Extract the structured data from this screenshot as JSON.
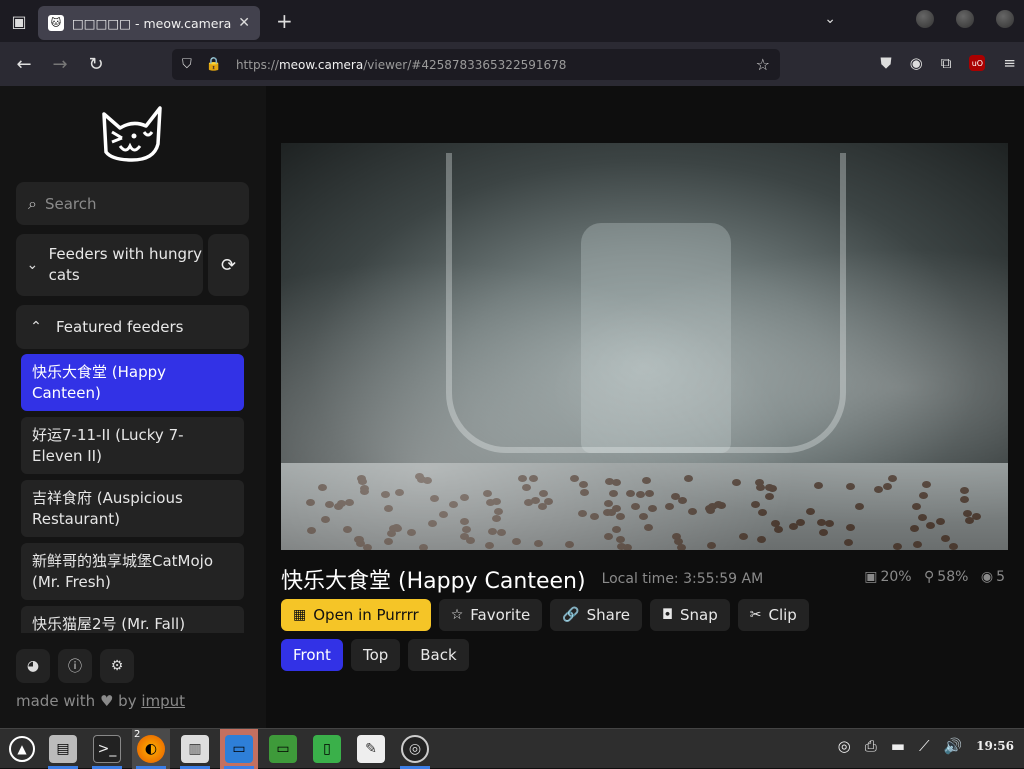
{
  "browser": {
    "tab_title": "□□□□□ - meow.camera",
    "url_prefix": "https://",
    "url_host": "meow.camera",
    "url_path": "/viewer/#4258783365322591678"
  },
  "sidebar": {
    "search_placeholder": "Search",
    "group_hungry": "Feeders with hungry cats",
    "group_featured": "Featured feeders",
    "feeders": [
      {
        "label": "快乐大食堂 (Happy Canteen)"
      },
      {
        "label": "好运7-11-II (Lucky 7-Eleven II)"
      },
      {
        "label": "吉祥食府 (Auspicious Restaurant)"
      },
      {
        "label": "新鲜哥的独享城堡CatMojo (Mr. Fresh)"
      },
      {
        "label": "快乐猫屋2号 (Mr. Fall)"
      }
    ],
    "made_with": "made with",
    "by": "by",
    "author": "imput"
  },
  "viewer": {
    "feeder_title": "快乐大食堂 (Happy Canteen)",
    "local_time": "Local time: 3:55:59 AM",
    "food_level": "20%",
    "health": "58%",
    "viewers": "5",
    "actions": {
      "open": "Open in Purrrr",
      "favorite": "Favorite",
      "share": "Share",
      "snap": "Snap",
      "clip": "Clip"
    },
    "views": {
      "front": "Front",
      "top": "Top",
      "back": "Back"
    }
  },
  "taskbar": {
    "clock": "19:56",
    "firefox_badge": "2"
  }
}
